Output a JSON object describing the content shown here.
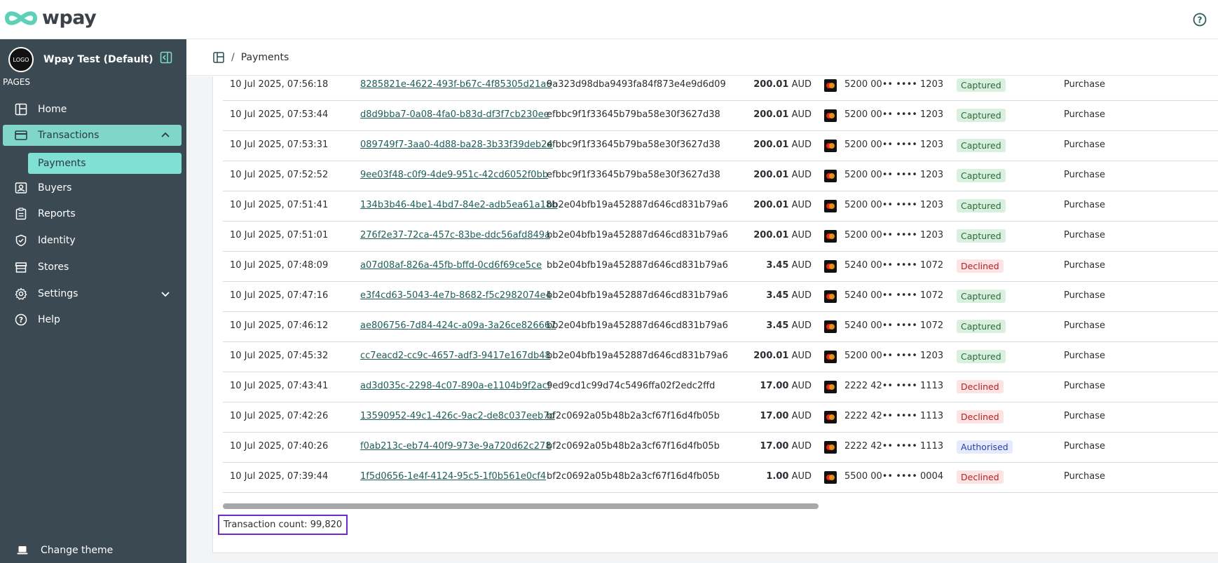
{
  "brand": {
    "name": "wpay",
    "accent": "#7fd6c9",
    "sidebar_bg": "#3b4a52"
  },
  "header": {
    "help_icon": "help-circle-icon"
  },
  "sidebar": {
    "org_logo_text": "LOGO",
    "org_name": "Wpay Test (Default)",
    "section_label": "PAGES",
    "items": [
      {
        "label": "Home",
        "icon": "home-icon"
      },
      {
        "label": "Transactions",
        "icon": "card-icon",
        "expanded": true
      },
      {
        "label": "Payments"
      },
      {
        "label": "Buyers",
        "icon": "buyers-icon"
      },
      {
        "label": "Reports",
        "icon": "reports-icon"
      },
      {
        "label": "Identity",
        "icon": "shield-icon"
      },
      {
        "label": "Stores",
        "icon": "store-icon"
      },
      {
        "label": "Settings",
        "icon": "gear-icon"
      },
      {
        "label": "Help",
        "icon": "help-icon"
      }
    ],
    "change_theme": "Change theme"
  },
  "breadcrumb": {
    "separator": "/",
    "current": "Payments"
  },
  "table": {
    "rows": [
      {
        "date": "10 Jul 2025, 07:56:18",
        "id": "8285821e-4622-493f-b67c-4f85305d21a6",
        "buyer": "9a323d98dba9493fa84f873e4e9d6d09",
        "amount": "200.01",
        "currency": "AUD",
        "card": "5200 00•• •••• 1203",
        "status": "Captured",
        "type": "Purchase"
      },
      {
        "date": "10 Jul 2025, 07:53:44",
        "id": "d8d9bba7-0a08-4fa0-b83d-df3f7cb230ee",
        "buyer": "efbbc9f1f33645b79ba58e30f3627d38",
        "amount": "200.01",
        "currency": "AUD",
        "card": "5200 00•• •••• 1203",
        "status": "Captured",
        "type": "Purchase"
      },
      {
        "date": "10 Jul 2025, 07:53:31",
        "id": "089749f7-3aa0-4d88-ba28-3b33f39deb24",
        "buyer": "efbbc9f1f33645b79ba58e30f3627d38",
        "amount": "200.01",
        "currency": "AUD",
        "card": "5200 00•• •••• 1203",
        "status": "Captured",
        "type": "Purchase"
      },
      {
        "date": "10 Jul 2025, 07:52:52",
        "id": "9ee03f48-c0f9-4de9-951c-42cd6052f0bb",
        "buyer": "efbbc9f1f33645b79ba58e30f3627d38",
        "amount": "200.01",
        "currency": "AUD",
        "card": "5200 00•• •••• 1203",
        "status": "Captured",
        "type": "Purchase"
      },
      {
        "date": "10 Jul 2025, 07:51:41",
        "id": "134b3b46-4be1-4bd7-84e2-adb5ea61a18b",
        "buyer": "bb2e04bfb19a452887d646cd831b79a6",
        "amount": "200.01",
        "currency": "AUD",
        "card": "5200 00•• •••• 1203",
        "status": "Captured",
        "type": "Purchase"
      },
      {
        "date": "10 Jul 2025, 07:51:01",
        "id": "276f2e37-72ca-457c-83be-ddc56afd849a",
        "buyer": "bb2e04bfb19a452887d646cd831b79a6",
        "amount": "200.01",
        "currency": "AUD",
        "card": "5200 00•• •••• 1203",
        "status": "Captured",
        "type": "Purchase"
      },
      {
        "date": "10 Jul 2025, 07:48:09",
        "id": "a07d08af-826a-45fb-bffd-0cd6f69ce5ce",
        "buyer": "bb2e04bfb19a452887d646cd831b79a6",
        "amount": "3.45",
        "currency": "AUD",
        "card": "5240 00•• •••• 1072",
        "status": "Declined",
        "type": "Purchase"
      },
      {
        "date": "10 Jul 2025, 07:47:16",
        "id": "e3f4cd63-5043-4e7b-8682-f5c2982074e4",
        "buyer": "bb2e04bfb19a452887d646cd831b79a6",
        "amount": "3.45",
        "currency": "AUD",
        "card": "5240 00•• •••• 1072",
        "status": "Captured",
        "type": "Purchase"
      },
      {
        "date": "10 Jul 2025, 07:46:12",
        "id": "ae806756-7d84-424c-a09a-3a26ce826667",
        "buyer": "bb2e04bfb19a452887d646cd831b79a6",
        "amount": "3.45",
        "currency": "AUD",
        "card": "5240 00•• •••• 1072",
        "status": "Captured",
        "type": "Purchase"
      },
      {
        "date": "10 Jul 2025, 07:45:32",
        "id": "cc7eacd2-cc9c-4657-adf3-9417e167db48",
        "buyer": "bb2e04bfb19a452887d646cd831b79a6",
        "amount": "200.01",
        "currency": "AUD",
        "card": "5200 00•• •••• 1203",
        "status": "Captured",
        "type": "Purchase"
      },
      {
        "date": "10 Jul 2025, 07:43:41",
        "id": "ad3d035c-2298-4c07-890a-e1104b9f2acf",
        "buyer": "9ed9cd1c99d74c5496ffa02f2edc2ffd",
        "amount": "17.00",
        "currency": "AUD",
        "card": "2222 42•• •••• 1113",
        "status": "Declined",
        "type": "Purchase"
      },
      {
        "date": "10 Jul 2025, 07:42:26",
        "id": "13590952-49c1-426c-9ac2-de8c037eeb7d",
        "buyer": "bf2c0692a05b48b2a3cf67f16d4fb05b",
        "amount": "17.00",
        "currency": "AUD",
        "card": "2222 42•• •••• 1113",
        "status": "Declined",
        "type": "Purchase"
      },
      {
        "date": "10 Jul 2025, 07:40:26",
        "id": "f0ab213c-eb74-40f9-973e-9a720d62c278",
        "buyer": "bf2c0692a05b48b2a3cf67f16d4fb05b",
        "amount": "17.00",
        "currency": "AUD",
        "card": "2222 42•• •••• 1113",
        "status": "Authorised",
        "type": "Purchase"
      },
      {
        "date": "10 Jul 2025, 07:39:44",
        "id": "1f5d0656-1e4f-4124-95c5-1f0b561e0cf4",
        "buyer": "bf2c0692a05b48b2a3cf67f16d4fb05b",
        "amount": "1.00",
        "currency": "AUD",
        "card": "5500 00•• •••• 0004",
        "status": "Declined",
        "type": "Purchase"
      }
    ]
  },
  "footer": {
    "transaction_count": "Transaction count: 99,820"
  },
  "status_colors": {
    "Captured": "#2a6a3a",
    "Declined": "#b32222",
    "Authorised": "#2a3fa6"
  }
}
